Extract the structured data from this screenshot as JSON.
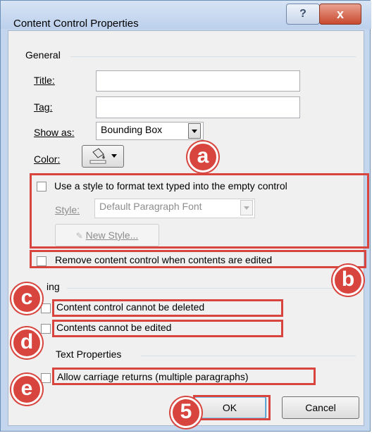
{
  "dialog": {
    "title": "Content Control Properties",
    "help_glyph": "?",
    "close_glyph": "x"
  },
  "general": {
    "group_label": "General",
    "title_label": "Title:",
    "title_value": "",
    "tag_label": "Tag:",
    "tag_value": "",
    "show_as_label": "Show as:",
    "show_as_value": "Bounding Box",
    "color_label": "Color:",
    "use_style_label": "Use a style to format text typed into the empty control",
    "style_label": "Style:",
    "style_value": "Default Paragraph Font",
    "new_style_label": "New Style...",
    "remove_label": "Remove content control when contents are edited"
  },
  "locking": {
    "group_label_partial": "ing",
    "cannot_delete_label": "Content control cannot be deleted",
    "cannot_edit_label": "Contents cannot be edited"
  },
  "text_props": {
    "group_label_partial": "Text Properties",
    "allow_cr_label": "Allow carriage returns (multiple paragraphs)"
  },
  "buttons": {
    "ok": "OK",
    "cancel": "Cancel"
  },
  "callouts": {
    "a": "a",
    "b": "b",
    "c": "c",
    "d": "d",
    "e": "e",
    "five": "5"
  },
  "colors": {
    "accent_red": "#d8453f",
    "title_bar": "#c4d6ee",
    "dialog_bg": "#f0f0f0"
  }
}
